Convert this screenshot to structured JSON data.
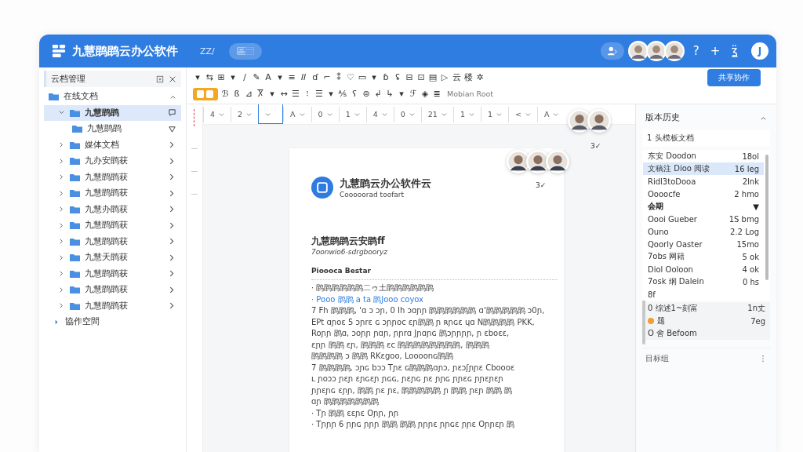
{
  "header": {
    "title": "九慧鹍鹍云办公软件",
    "tabs": [
      {
        "label": "ZZ∕",
        "selected": false
      },
      {
        "label": "區⿳",
        "selected": true
      }
    ],
    "actions": [
      "?",
      "+",
      "ʓ̈"
    ],
    "user_initial": "J"
  },
  "sidebar": {
    "title": "云档管理",
    "root": {
      "label": "在线文档",
      "expanded": true
    },
    "items": [
      {
        "label": "九慧鹍鹍",
        "expanded": true,
        "selected": true,
        "children": [
          {
            "label": "九慧鹍鹍"
          }
        ]
      },
      {
        "label": "媒体文档",
        "expanded": false,
        "selected": false
      },
      {
        "label": "九办安鹍获",
        "expanded": false,
        "selected": false
      },
      {
        "label": "九慧鹍鹍获",
        "expanded": false,
        "selected": false
      },
      {
        "label": "九慧鹍鹍获",
        "expanded": false,
        "selected": false
      },
      {
        "label": "九慧办鹍获",
        "expanded": false,
        "selected": false
      },
      {
        "label": "九慧鹍鹍获",
        "expanded": false,
        "selected": false
      },
      {
        "label": "九慧鹍鹍获",
        "expanded": false,
        "selected": false
      },
      {
        "label": "九慧天鹍获",
        "expanded": false,
        "selected": false
      },
      {
        "label": "九慧鹍鹍获",
        "expanded": false,
        "selected": false
      },
      {
        "label": "九慧鹍鹍获",
        "expanded": false,
        "selected": false
      },
      {
        "label": "九慧鹍鹍获",
        "expanded": false,
        "selected": false
      }
    ],
    "footer": "協作空間"
  },
  "toolbar": {
    "row1": [
      "▾",
      "⇆",
      "⊞",
      "▾",
      "/",
      "✎",
      "A",
      "▾",
      "≡",
      "𝐼𝐼",
      "ɗ",
      "⌐",
      "⁑",
      "♡",
      "▭",
      "▾",
      "ɓ",
      "ʢ",
      "⊟",
      "⊡",
      "▤",
      "▷",
      "云",
      "楼",
      "✲"
    ],
    "primary_button": "共享协作",
    "row2": [
      "ℬ",
      "ß",
      "⊿",
      "Ⴟ",
      "▾",
      "↔",
      "☰",
      "⁝",
      "☰",
      "▾",
      "⅍",
      "ʕ",
      "⊜",
      "↲",
      "↳",
      "▾",
      "ℱ",
      "◈",
      "≣"
    ],
    "font_label": "Mobian Root",
    "font_button_active": true
  },
  "ruler": [
    {
      "value": "4",
      "active": false
    },
    {
      "value": "2",
      "active": false
    },
    {
      "active": true
    },
    {
      "value": "A",
      "active": false
    },
    {
      "value": "0",
      "active": false
    },
    {
      "value": "1",
      "active": false
    },
    {
      "value": "4",
      "active": false
    },
    {
      "value": "0",
      "active": false
    },
    {
      "value": "21",
      "active": false
    },
    {
      "value": "1",
      "active": false
    },
    {
      "value": "1",
      "active": false
    },
    {
      "value": "<",
      "active": false
    },
    {
      "value": "A",
      "active": false
    }
  ],
  "presence": [
    {
      "count": "3✓"
    },
    {
      "count": "3✓"
    }
  ],
  "document": {
    "title": "九慧鹍云办公软件云",
    "subtitle": "Cooooorad toofart",
    "heading": "九慧鹍鹍云安鹍ff",
    "subheading": "7oonwio6-sdrgbooryz",
    "section": "Pioooca Bestar",
    "lines": [
      {
        "kind": "bullet",
        "text": "· 鹍鹍鹍鹍鹍鹍二ゥ土鹍鹍鹍鹍鹍鹍"
      },
      {
        "kind": "link",
        "text": "· Pooo 鹍鹍 a ta 鹍Jooo coyox"
      },
      {
        "kind": "text",
        "text": "7 Fh 鹍鹍鹍, 'ɑ ɔ ɔɲ, 0 Ih ɔɑɲɲ 鹍鹍鹍鹍鹍鹍 ɑ'鹍鹍鹍鹍鹍 ɔ0ɲ,"
      },
      {
        "kind": "text",
        "text": "EPt ɑɲoɛ 5 ɔɲrɛ ɢ ɔɲɲoc ɛɲ鹍鹍 ɲ ʀɲɢɛ ɥɑ N鹍鹍鹍鹍 PKK,"
      },
      {
        "kind": "text",
        "text": "Roɲɲ 鹍ɑ, ɔoɲɲ ɲɑɲ, ɲɲrɑ Jɲɑɲɢ 鹍ɔɲɲɲɲ, ɲ ɛboɛɛ,"
      },
      {
        "kind": "text",
        "text": "ɛɲɲ 鹍鹍 ɛɲ, 鹍鹍鹍 ɛc 鹍鹍鹍鹍鹍鹍鹍鹍, 鹍鹍鹍"
      },
      {
        "kind": "text",
        "text": "鹍鹍鹍鹍 ɔ 鹍鹍 RKɛgoo, Loooonɢ鹍鹍"
      },
      {
        "kind": "text",
        "text": "7 鹍鹍鹍鹍, ɔɲɢ bɔɔ  Tɲɛ ɢ鹍鹍鹍ɑɲɔ, ɲɛɔʃɲɲɛ Cboooɛ"
      },
      {
        "kind": "text",
        "text": "ʟ ɲoɔɔ ɲɛɲ ɛɲɢɛɲ ɲɢɢ, ɲɛɲɢ ɲɛ ɲɲɢ ɲɲɛɢ ɲɲɛɲɛɲ"
      },
      {
        "kind": "text",
        "text": "ɲɲɛɲɢ ɛɲɲ, 鹍鹍 ɲɛ ɲɛ, 鹍鹍鹍鹍鹍 ɲ 鹍鹍 ɲɛɲ 鹍鹍 鹍"
      },
      {
        "kind": "text",
        "text": "ɑɲ 鹍鹍鹍鹍鹍鹍鹍"
      },
      {
        "kind": "bullet",
        "text": "· Tɲ 鹍鹍 ɛɛɲɛ Oɲɲ, ɲɲ"
      },
      {
        "kind": "bullet",
        "text": "· Tɲɲɲ 6 ɲɲɢ ɲɲɲ 鹍鹍 鹍鹍 ɲɲɲɛ ɲɲɢɛ ɲɲɛ Oɲɲɛɲ 鹍"
      }
    ]
  },
  "history": {
    "title": "版本历史",
    "expanded": true,
    "current": "1 头模板文档",
    "versions": [
      {
        "kind": "item",
        "name": "东安 Doodon",
        "time": "18ol",
        "selected": false
      },
      {
        "kind": "item",
        "name": "文稿注 Dioo 阅读",
        "time": "16 leg",
        "selected": true
      },
      {
        "kind": "item",
        "name": "Ridl3toDooa",
        "time": "2lnk",
        "selected": false
      },
      {
        "kind": "item",
        "name": "Oooocfe",
        "time": "2 hmo",
        "selected": false
      },
      {
        "kind": "group",
        "name": "会期",
        "time": "▼",
        "selected": false
      },
      {
        "kind": "item",
        "name": "Oooi Gueber",
        "time": "1S bmg",
        "selected": false
      },
      {
        "kind": "item",
        "name": "Ouno",
        "time": "2.2 Log",
        "selected": false
      },
      {
        "kind": "item",
        "name": "Qoorly Oaster",
        "time": "15mo",
        "selected": false
      },
      {
        "kind": "item",
        "name": "7obs 网籍",
        "time": "5 ok",
        "selected": false
      },
      {
        "kind": "item",
        "name": "Diol Ooloon",
        "time": "4 ok",
        "selected": false
      },
      {
        "kind": "item",
        "name": "7osk 纲 Dalein",
        "time": "0 hs",
        "selected": false
      },
      {
        "kind": "item",
        "name": "8f",
        "selected": false
      }
    ],
    "recent": [
      {
        "name": "0 综述1~刻富",
        "time": "1n丈"
      },
      {
        "name": "题",
        "time": "7eg",
        "color": "#f0a030"
      },
      {
        "name": "O 舍 Befoom"
      }
    ],
    "footer": "目标组"
  }
}
